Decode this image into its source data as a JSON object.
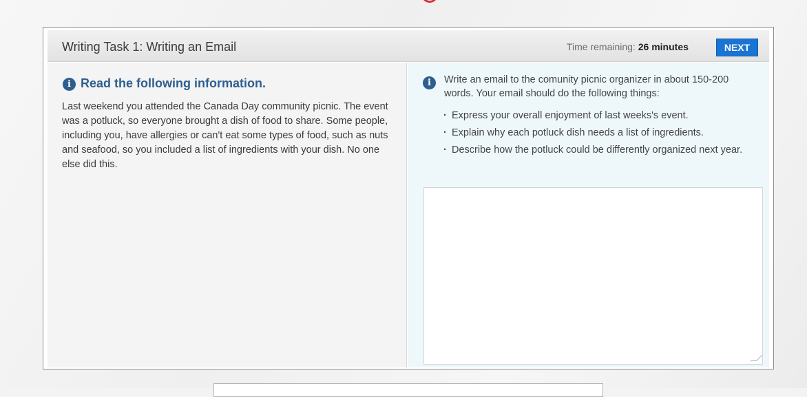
{
  "header": {
    "title": "Writing Task 1: Writing an Email",
    "timer_label": "Time remaining:",
    "timer_value": "26 minutes",
    "next_label": "NEXT"
  },
  "left": {
    "icon": "info-icon",
    "heading": "Read the following information.",
    "body": "Last weekend you attended the Canada Day community picnic. The event was a potluck, so everyone brought a dish of food to share. Some people, including you, have allergies or can't eat some types of food, such as nuts and seafood, so you included a list of ingredients with your dish. No one else did this."
  },
  "right": {
    "icon": "info-icon",
    "intro": "Write an email to the comunity picnic organizer in about 150-200 words. Your email should do the following things:",
    "bullets": [
      "Express your overall enjoyment of last weeks's event.",
      "Explain why each potluck dish needs a list of ingredients.",
      "Describe how the potluck could be differently organized next year."
    ],
    "response_value": ""
  },
  "colors": {
    "accent_blue": "#1a74d4",
    "heading_blue": "#2d5f8e",
    "right_pane_bg": "#eef8fb",
    "left_pane_bg": "#f4f4f4"
  }
}
